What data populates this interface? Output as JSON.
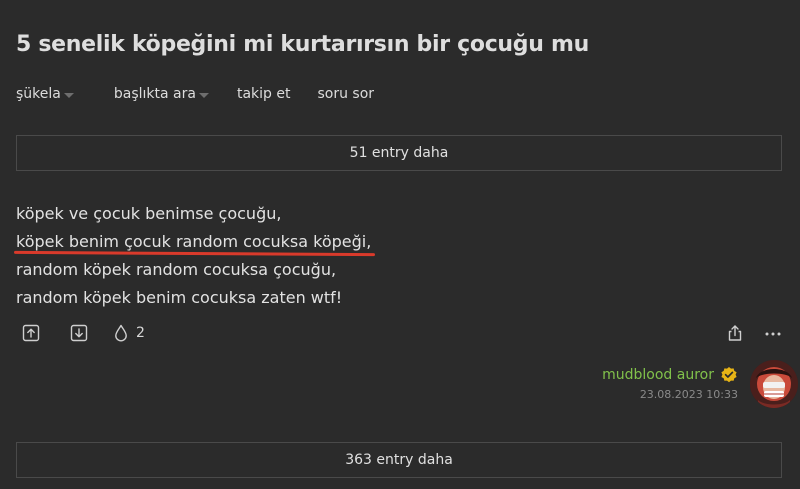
{
  "topic": {
    "title": "5 senelik köpeğini mi kurtarırsın bir çocuğu mu"
  },
  "subnav": {
    "sukela": "şükela",
    "search_in_topic": "başlıkta ara",
    "follow": "takip et",
    "ask": "soru sor"
  },
  "more_top": "51 entry daha",
  "entry": {
    "lines": [
      "köpek ve çocuk benimse çocuğu,",
      "köpek benim çocuk random cocuksa köpeği,",
      "random köpek random cocuksa çocuğu,",
      "random köpek benim cocuksa zaten wtf!"
    ],
    "favorite_count": "2",
    "author": "mudblood auror",
    "date": "23.08.2023 10:33"
  },
  "more_bottom": "363 entry daha",
  "icons": {
    "upvote": "arrow-up-box-icon",
    "downvote": "arrow-down-box-icon",
    "favorite": "drop-icon",
    "share": "share-icon",
    "more": "ellipsis-icon",
    "verified": "verified-badge-icon"
  },
  "colors": {
    "background": "#2b2b2b",
    "author": "#81c14b",
    "highlight_underline": "#d93a2b",
    "verified_badge": "#e7b416"
  }
}
